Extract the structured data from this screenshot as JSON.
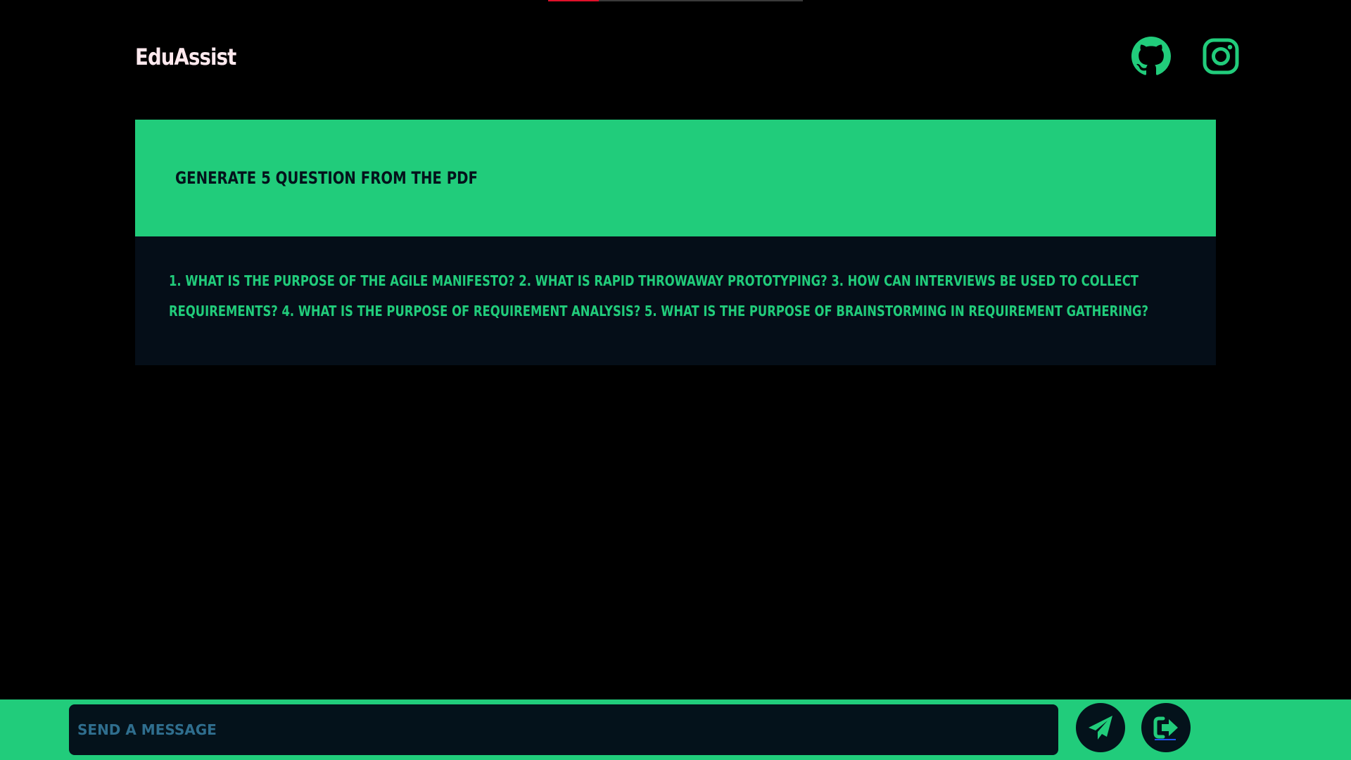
{
  "header": {
    "brand": "EduAssist",
    "links": [
      {
        "icon": "github-icon"
      },
      {
        "icon": "instagram-icon"
      }
    ]
  },
  "loading_progress": 0.2,
  "conversation": {
    "prompt": "GENERATE 5 QUESTION FROM THE PDF",
    "response": "1. WHAT IS THE PURPOSE OF THE AGILE MANIFESTO? 2. WHAT IS RAPID THROWAWAY PROTOTYPING? 3. HOW CAN INTERVIEWS BE USED TO COLLECT REQUIREMENTS? 4. WHAT IS THE PURPOSE OF REQUIREMENT ANALYSIS? 5. WHAT IS THE PURPOSE OF BRAINSTORMING IN REQUIREMENT GATHERING?"
  },
  "composer": {
    "placeholder": "SEND A MESSAGE",
    "value": "",
    "send_icon": "send-icon",
    "logout_icon": "logout-icon"
  },
  "colors": {
    "accent": "#21cc7b",
    "background": "#000000",
    "panel": "#050e18",
    "brand_text": "#ffe9ee",
    "progress": "#e0102a"
  }
}
